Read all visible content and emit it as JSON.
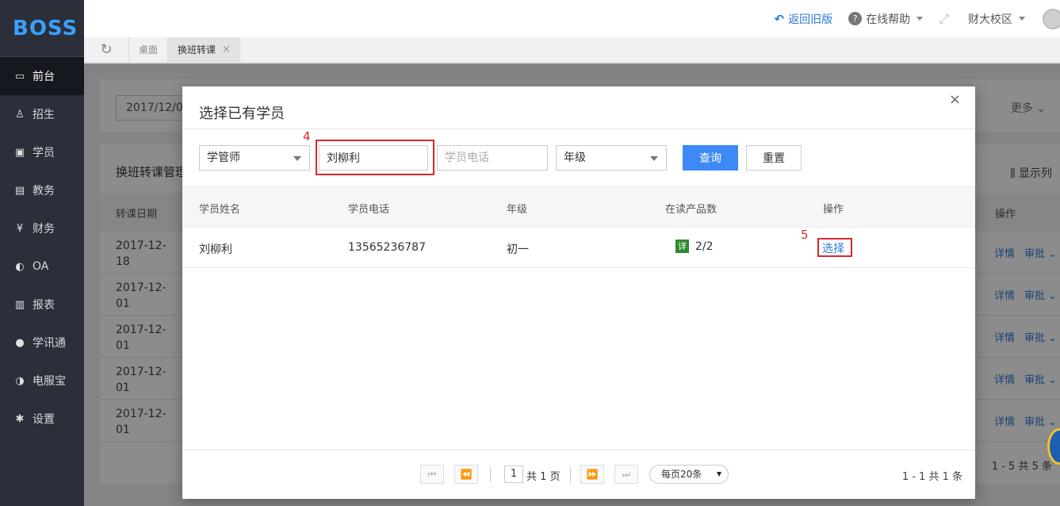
{
  "sidebar": {
    "logo": "BOSS",
    "items": [
      {
        "label": "前台",
        "icon": "calendar-icon",
        "glyph": "▭"
      },
      {
        "label": "招生",
        "icon": "user-add-icon",
        "glyph": "♙"
      },
      {
        "label": "学员",
        "icon": "student-card-icon",
        "glyph": "▣"
      },
      {
        "label": "教务",
        "icon": "book-icon",
        "glyph": "▤"
      },
      {
        "label": "财务",
        "icon": "money-icon",
        "glyph": "¥"
      },
      {
        "label": "OA",
        "icon": "toggle-icon",
        "glyph": "◐"
      },
      {
        "label": "报表",
        "icon": "bar-chart-icon",
        "glyph": "▥"
      },
      {
        "label": "学讯通",
        "icon": "location-icon",
        "glyph": "●"
      },
      {
        "label": "电服宝",
        "icon": "phone-icon",
        "glyph": "◑"
      },
      {
        "label": "设置",
        "icon": "gear-icon",
        "glyph": "✱"
      }
    ]
  },
  "header": {
    "back_label": "返回旧版",
    "help_label": "在线帮助",
    "campus_label": "财大校区"
  },
  "tabs": [
    {
      "label": "桌面"
    },
    {
      "label": "换班转课"
    }
  ],
  "background": {
    "date_value": "2017/12/0",
    "more_label": "更多",
    "list_title": "换班转课管理",
    "show_columns": "显示列",
    "col_date": "转课日期",
    "col_ops": "操作",
    "rows": [
      {
        "date": "2017-12-18"
      },
      {
        "date": "2017-12-01"
      },
      {
        "date": "2017-12-01"
      },
      {
        "date": "2017-12-01"
      },
      {
        "date": "2017-12-01"
      }
    ],
    "op_detail": "详情",
    "op_approve": "审批",
    "pager": "1 - 5  共 5 条"
  },
  "modal": {
    "title": "选择已有学员",
    "filters": {
      "teacher_select": "学管师",
      "name_value": "刘柳利",
      "phone_placeholder": "学员电话",
      "grade_select": "年级",
      "query_label": "查询",
      "reset_label": "重置"
    },
    "markers": {
      "name": "4",
      "select": "5"
    },
    "columns": [
      "学员姓名",
      "学员电话",
      "年级",
      "在读产品数",
      "操作"
    ],
    "rows": [
      {
        "name": "刘柳利",
        "phone": "13565236787",
        "grade": "初一",
        "badge": "详",
        "products": "2/2",
        "action": "选择"
      }
    ],
    "pagination": {
      "page": "1",
      "total_pages": "共 1 页",
      "page_size": "每页20条",
      "info": "1 - 1  共 1 条"
    }
  },
  "colors": {
    "sidebar_bg": "#2b2f3a",
    "accent": "#3d8af7",
    "link": "#2d7ad6",
    "highlight": "#d9282c",
    "badge": "#2e8b2e"
  }
}
